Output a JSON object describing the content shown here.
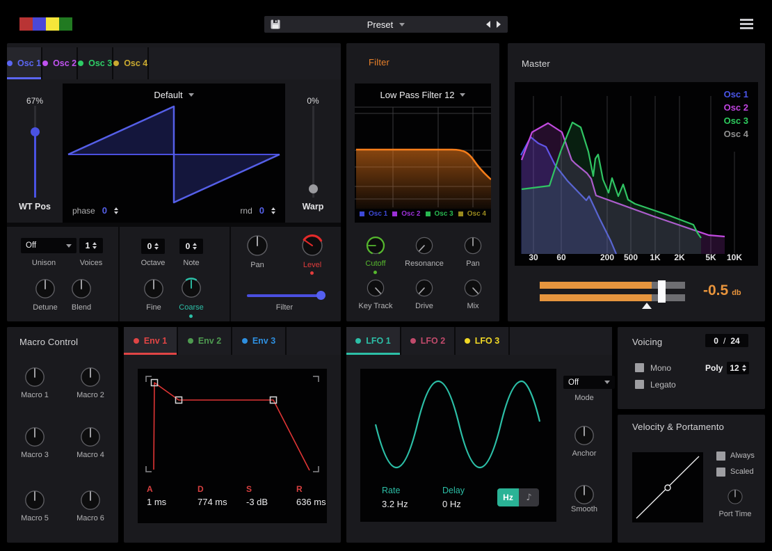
{
  "topbar": {
    "preset_label": "Preset"
  },
  "osc": {
    "tabs": [
      {
        "label": "Osc 1",
        "color": "#5b66f2"
      },
      {
        "label": "Osc 2",
        "color": "#bf52ef"
      },
      {
        "label": "Osc 3",
        "color": "#2ecc66"
      },
      {
        "label": "Osc 4",
        "color": "#c9a930"
      }
    ],
    "wt_pos": {
      "value": "67%",
      "label": "WT Pos"
    },
    "warp": {
      "value": "0%",
      "label": "Warp"
    },
    "wavetable_name": "Default",
    "phase": {
      "label": "phase",
      "value": "0"
    },
    "rnd": {
      "label": "rnd",
      "value": "0"
    },
    "unison": {
      "value": "Off",
      "label": "Unison"
    },
    "voices": {
      "value": "1",
      "label": "Voices"
    },
    "octave": {
      "value": "0",
      "label": "Octave"
    },
    "note": {
      "value": "0",
      "label": "Note"
    },
    "detune_label": "Detune",
    "blend_label": "Blend",
    "fine_label": "Fine",
    "coarse_label": "Coarse",
    "pan_label": "Pan",
    "level_label": "Level",
    "filter_slider_label": "Filter"
  },
  "filter": {
    "title": "Filter",
    "type": "Low Pass Filter 12",
    "legend": [
      {
        "label": "Osc 1",
        "color": "#3d49d8"
      },
      {
        "label": "Osc 2",
        "color": "#9c30d8"
      },
      {
        "label": "Osc 3",
        "color": "#28b850"
      },
      {
        "label": "Osc 4",
        "color": "#9a8a1e"
      }
    ],
    "knob_labels": [
      "Cutoff",
      "Resonance",
      "Pan",
      "Key Track",
      "Drive",
      "Mix"
    ]
  },
  "master": {
    "title": "Master",
    "legend": [
      {
        "label": "Osc 1",
        "color": "#4a55e8"
      },
      {
        "label": "Osc 2",
        "color": "#c044e0"
      },
      {
        "label": "Osc 3",
        "color": "#2ecc5e"
      },
      {
        "label": "Osc 4",
        "color": "#8f8f8f"
      }
    ],
    "freq_ticks": [
      "30",
      "60",
      "200",
      "500",
      "1K",
      "2K",
      "5K",
      "10K"
    ],
    "volume": {
      "value": "-0.5",
      "unit": "db"
    }
  },
  "macro": {
    "title": "Macro Control",
    "knob_labels": [
      "Macro 1",
      "Macro 2",
      "Macro 3",
      "Macro 4",
      "Macro 5",
      "Macro 6"
    ]
  },
  "env": {
    "tabs": [
      {
        "label": "Env 1",
        "color": "#e04545"
      },
      {
        "label": "Env 2",
        "color": "#4e9a50"
      },
      {
        "label": "Env 3",
        "color": "#2e8fe0"
      }
    ],
    "params": [
      {
        "name": "A",
        "value": "1 ms"
      },
      {
        "name": "D",
        "value": "774 ms"
      },
      {
        "name": "S",
        "value": "-3 dB"
      },
      {
        "name": "R",
        "value": "636 ms"
      }
    ]
  },
  "lfo": {
    "tabs": [
      {
        "label": "LFO 1",
        "color": "#2cbfa7"
      },
      {
        "label": "LFO 2",
        "color": "#c04a6b"
      },
      {
        "label": "LFO 3",
        "color": "#f0d825"
      }
    ],
    "rate": {
      "label": "Rate",
      "value": "3.2 Hz"
    },
    "delay": {
      "label": "Delay",
      "value": "0 Hz"
    },
    "hz_toggle": "Hz",
    "mode": {
      "value": "Off",
      "label": "Mode"
    },
    "anchor_label": "Anchor",
    "smooth_label": "Smooth"
  },
  "voicing": {
    "title": "Voicing",
    "active": "0",
    "sep": "/",
    "max": "24",
    "mono_label": "Mono",
    "legato_label": "Legato",
    "poly_label": "Poly",
    "poly_value": "12"
  },
  "velocity": {
    "title": "Velocity & Portamento",
    "always_label": "Always",
    "scaled_label": "Scaled",
    "port_time_label": "Port Time"
  }
}
